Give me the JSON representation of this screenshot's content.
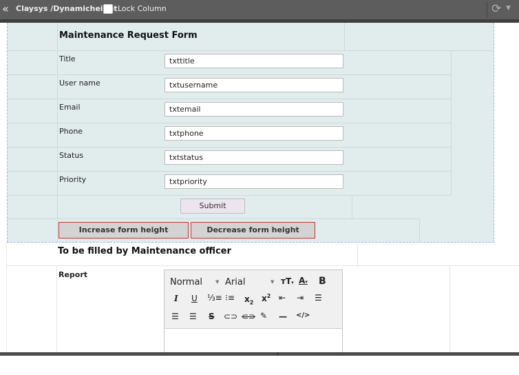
{
  "topbar": {
    "title": "Claysys /Dynamicheight",
    "lock_column_label": "Lock Column",
    "back_icon": "double-chevron-left-icon",
    "refresh_icon": "refresh-icon"
  },
  "form": {
    "title": "Maintenance Request Form",
    "fields": [
      {
        "label": "Title",
        "value": "txttitle"
      },
      {
        "label": "User name",
        "value": "txtusername"
      },
      {
        "label": "Email",
        "value": "txtemail"
      },
      {
        "label": "Phone",
        "value": "txtphone"
      },
      {
        "label": "Status",
        "value": "txtstatus"
      },
      {
        "label": "Priority",
        "value": "txtpriority"
      }
    ],
    "submit_label": "Submit",
    "increase_label": "Increase form height",
    "decrease_label": "Decrease form height"
  },
  "officer_section": {
    "title": "To be filled by Maintenance officer",
    "report_label": "Report",
    "editor": {
      "format_value": "Normal",
      "font_value": "Arial",
      "toolbar_icons": [
        "font-size-icon",
        "text-color-icon",
        "bold-icon",
        "italic-icon",
        "underline-icon",
        "ordered-list-icon",
        "unordered-list-icon",
        "subscript-icon",
        "superscript-icon",
        "outdent-icon",
        "indent-icon",
        "align-left-icon",
        "align-center-icon",
        "align-right-icon",
        "strikethrough-icon",
        "link-icon",
        "unlink-icon",
        "clear-format-icon",
        "horizontal-rule-icon",
        "source-code-icon"
      ]
    }
  },
  "colors": {
    "form_background": "#e1ecec",
    "topbar": "#5d5d5d",
    "button_border": "#c93333"
  }
}
